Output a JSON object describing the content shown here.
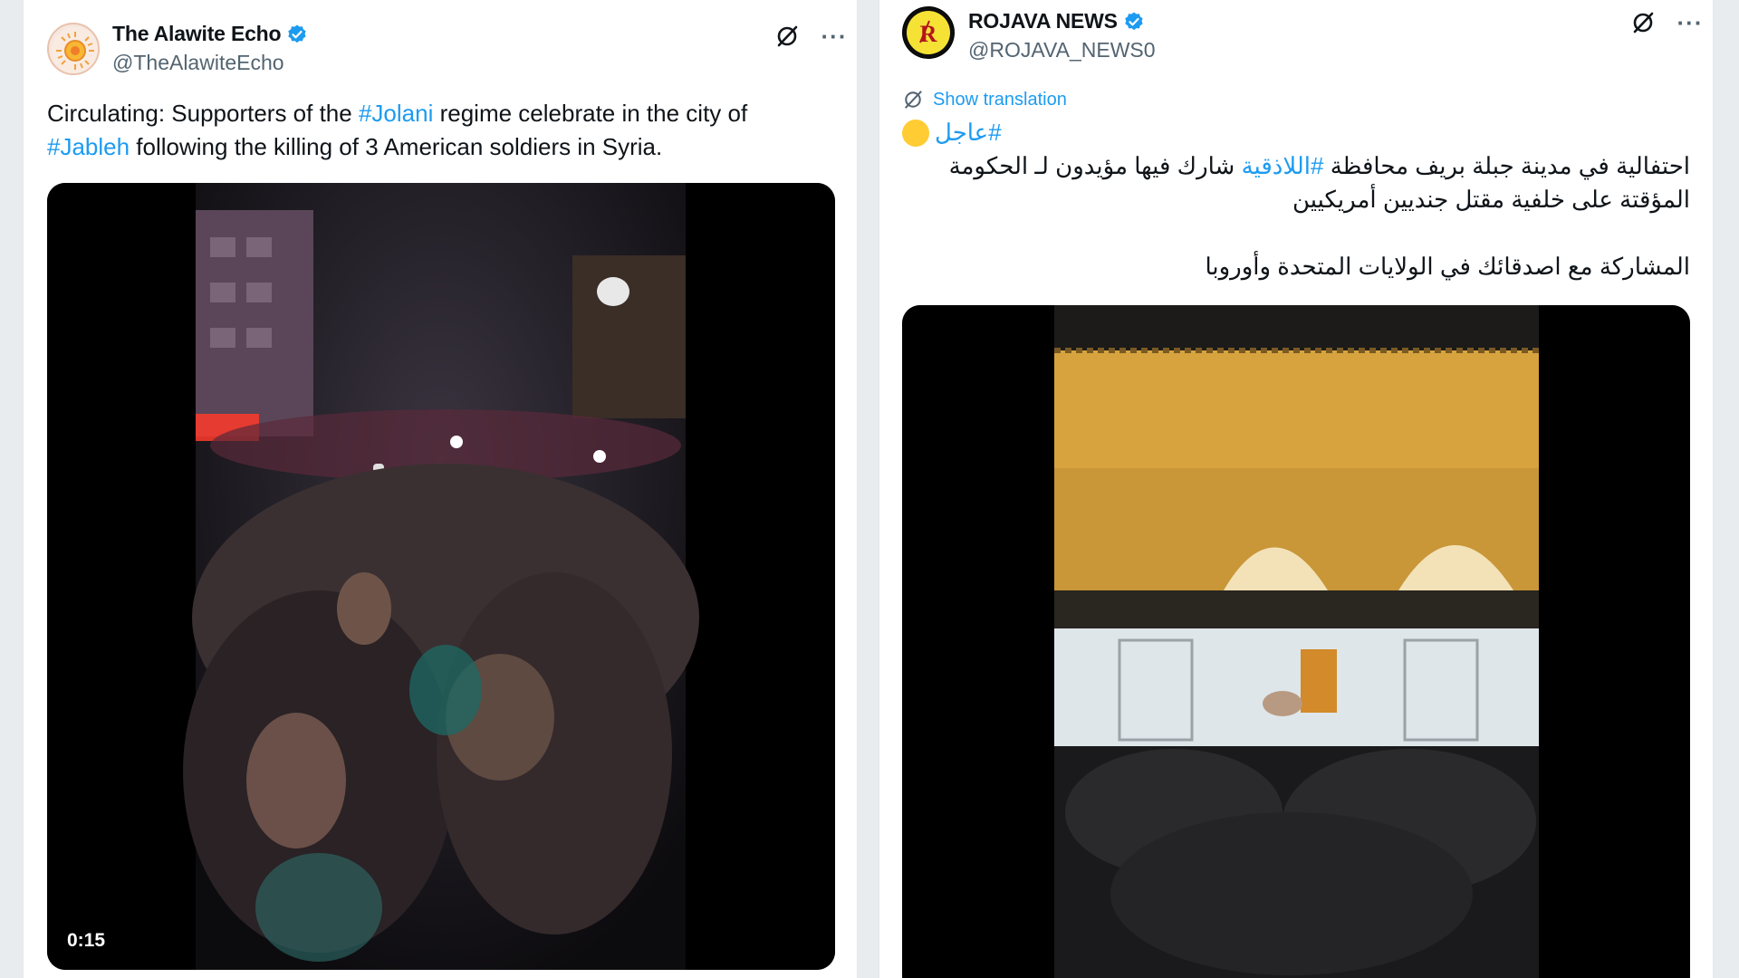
{
  "left_post": {
    "display_name": "The Alawite Echo",
    "handle": "@TheAlawiteEcho",
    "text_pre": "Circulating: Supporters of the ",
    "tag1": "#Jolani",
    "text_mid": " regime celebrate in the city of",
    "tag2": "#Jableh",
    "text_post": " following the killing of 3 American soldiers in Syria.",
    "video_time": "0:15",
    "more_label": "···"
  },
  "right_post": {
    "display_name": "ROJAVA NEWS",
    "handle": "@ROJAVA_NEWS0",
    "translate_label": "Show translation",
    "more_label": "···",
    "line1_tag": "#عاجل",
    "line2_pre": "احتفالية في مدينة جبلة بريف محافظة ",
    "line2_tag": "#اللاذقية",
    "line2_post": " شارك فيها مؤيدون لـ الحكومة",
    "line3": "المؤقتة على خلفية مقتل جنديين أمريكيين",
    "line4": "المشاركة مع اصدقائك في الولايات المتحدة وأوروبا"
  },
  "colors": {
    "accent": "#1d9bf0",
    "muted": "#536471",
    "verified": "#1d9bf0",
    "emoji_circle": "#ffcc33"
  },
  "icons": [
    "grok-icon",
    "more-icon",
    "verified-badge-icon",
    "translate-icon"
  ]
}
